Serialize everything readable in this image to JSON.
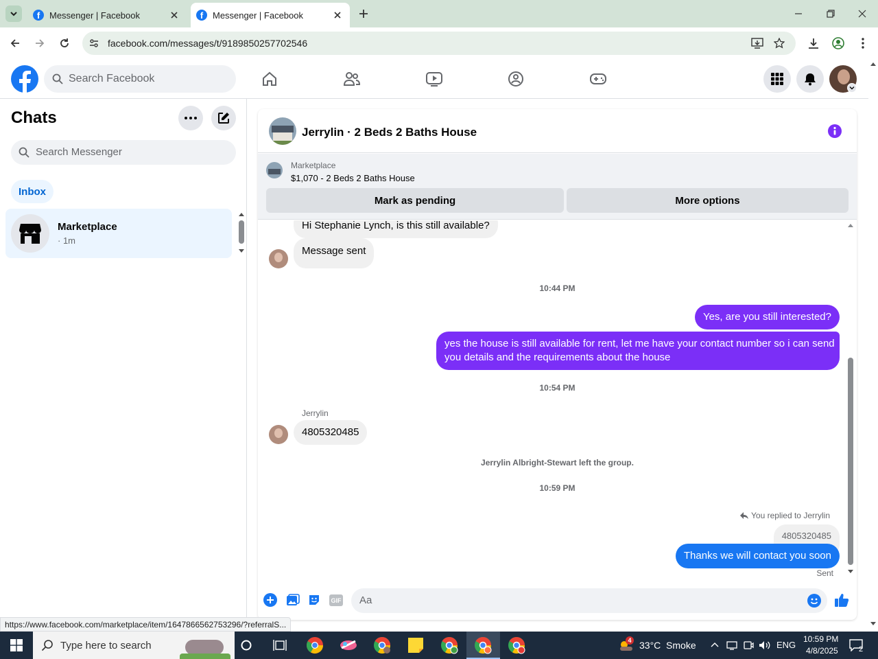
{
  "browser": {
    "tabs": [
      {
        "title": "Messenger | Facebook"
      },
      {
        "title": "Messenger | Facebook"
      }
    ],
    "url": "facebook.com/messages/t/9189850257702546",
    "status_link": "https://www.facebook.com/marketplace/item/1647866562753296/?referralS..."
  },
  "fb_header": {
    "search_placeholder": "Search Facebook"
  },
  "sidebar": {
    "title": "Chats",
    "search_placeholder": "Search Messenger",
    "filter": "Inbox",
    "conversations": [
      {
        "name": "Marketplace",
        "time": "· 1m"
      }
    ]
  },
  "chat": {
    "title": "Jerrylin · 2 Beds 2 Baths House",
    "marketplace_label": "Marketplace",
    "listing": "$1,070 - 2 Beds 2 Baths House",
    "mark_pending": "Mark as pending",
    "more_options": "More options",
    "messages": {
      "m1": "Hi Stephanie Lynch, is this still available?",
      "m2": "Message sent",
      "t1": "10:44 PM",
      "m3": "Yes, are you still interested?",
      "m4_line1": "yes the house is still available for rent, let me have your contact number so i can send",
      "m4_line2": "you details and the requirements about the house",
      "t2": "10:54 PM",
      "sender": "Jerrylin",
      "m5": "4805320485",
      "event": "Jerrylin Albright-Stewart left the group.",
      "t3": "10:59 PM",
      "replied_to": "You replied to Jerrylin",
      "quoted": "4805320485",
      "m6": "Thanks we will contact you soon",
      "status": "Sent"
    },
    "composer_placeholder": "Aa"
  },
  "taskbar": {
    "search_placeholder": "Type here to search",
    "weather": "33°C  Smoke",
    "weather_badge": "4",
    "lang": "ENG",
    "time": "10:59 PM",
    "date": "4/8/2025",
    "notif_count": "2"
  },
  "colors": {
    "fb_blue": "#1877f2",
    "outgoing_purple": "#7b2ff7",
    "taskbar": "#1c2b3d"
  }
}
